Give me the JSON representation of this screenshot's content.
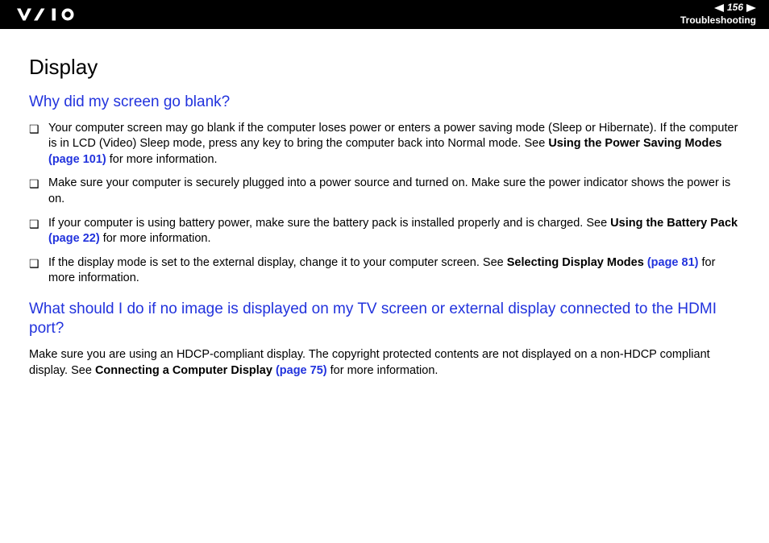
{
  "header": {
    "page_number": "156",
    "section": "Troubleshooting"
  },
  "content": {
    "title": "Display",
    "q1": {
      "heading": "Why did my screen go blank?",
      "items": [
        {
          "pre": "Your computer screen may go blank if the computer loses power or enters a power saving mode (Sleep or Hibernate). If the computer is in LCD (Video) Sleep mode, press any key to bring the computer back into Normal mode. See ",
          "bold": "Using the Power Saving Modes ",
          "link": "(page 101)",
          "post": " for more information."
        },
        {
          "pre": "Make sure your computer is securely plugged into a power source and turned on. Make sure the power indicator shows the power is on.",
          "bold": "",
          "link": "",
          "post": ""
        },
        {
          "pre": "If your computer is using battery power, make sure the battery pack is installed properly and is charged. See ",
          "bold": "Using the Battery Pack ",
          "link": "(page 22)",
          "post": " for more information."
        },
        {
          "pre": "If the display mode is set to the external display, change it to your computer screen. See ",
          "bold": "Selecting Display Modes ",
          "link": "(page 81)",
          "post": " for more information."
        }
      ]
    },
    "q2": {
      "heading": "What should I do if no image is displayed on my TV screen or external display connected to the HDMI port?",
      "para_pre": "Make sure you are using an HDCP-compliant display. The copyright protected contents are not displayed on a non-HDCP compliant display. See ",
      "para_bold": "Connecting a Computer Display ",
      "para_link": "(page 75)",
      "para_post": " for more information."
    }
  }
}
